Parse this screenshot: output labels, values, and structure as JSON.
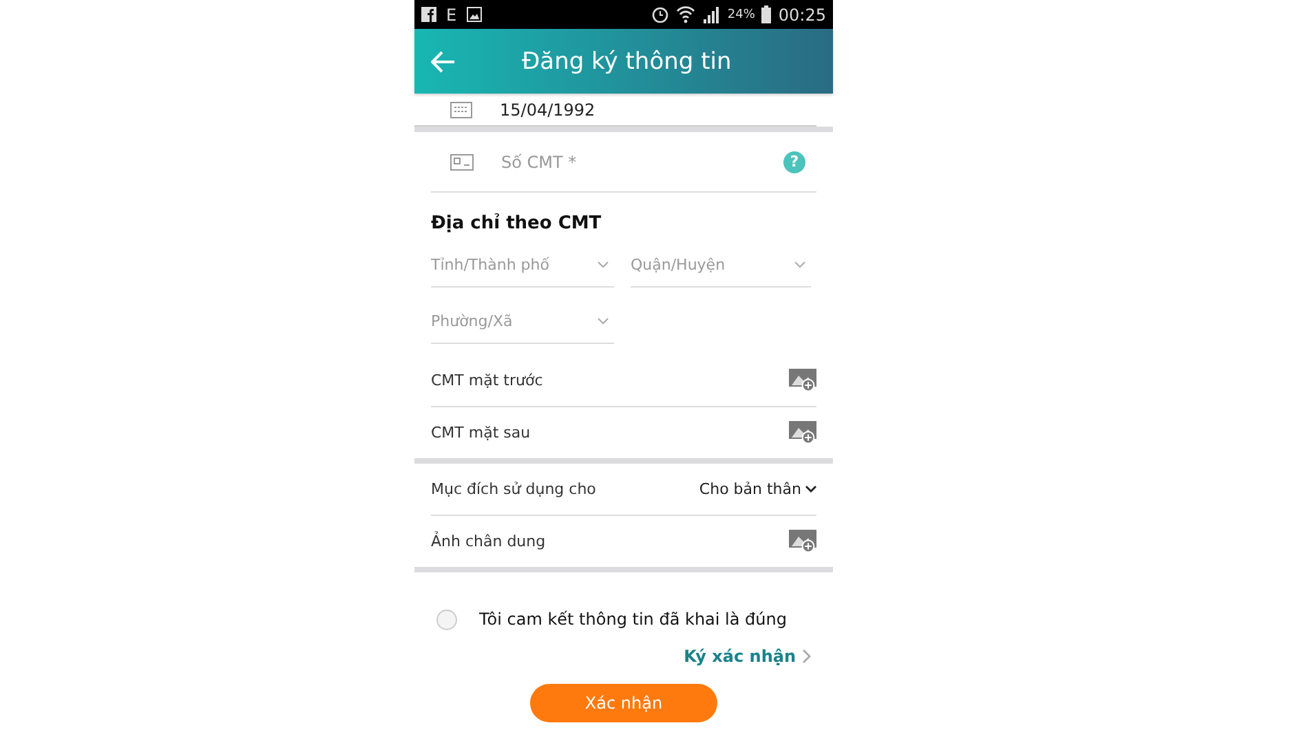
{
  "status_bar": {
    "network": "E",
    "battery": "24%",
    "time": "00:25"
  },
  "header": {
    "title": "Đăng ký thông tin"
  },
  "date_field": {
    "value": "15/04/1992"
  },
  "id_field": {
    "placeholder": "Số CMT *",
    "help": "?"
  },
  "address": {
    "heading": "Địa chỉ theo CMT",
    "selects": [
      {
        "placeholder": "Tỉnh/Thành phố"
      },
      {
        "placeholder": "Quận/Huyện"
      },
      {
        "placeholder": "Phường/Xã"
      }
    ]
  },
  "sections": [
    [
      {
        "kind": "photo",
        "label": "CMT mặt trước"
      },
      {
        "kind": "photo",
        "label": "CMT mặt sau"
      }
    ],
    [
      {
        "kind": "select",
        "label": "Mục đích sử dụng cho",
        "value": "Cho bản thân"
      },
      {
        "kind": "photo",
        "label": "Ảnh chân dung"
      }
    ]
  ],
  "commitment": {
    "label": "Tôi cam kết thông tin đã khai là đúng",
    "checked": false
  },
  "sign_link": "Ký xác nhận",
  "submit": "Xác nhận"
}
